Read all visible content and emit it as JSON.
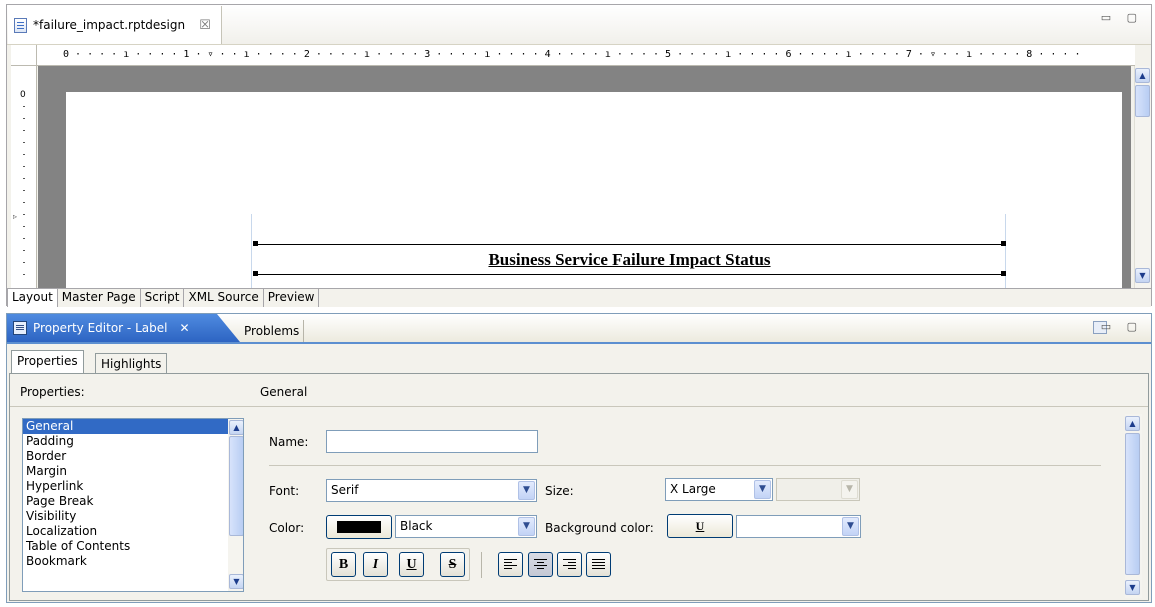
{
  "editor": {
    "tab_title": "*failure_impact.rptdesign",
    "tab_close_glyph": "☒",
    "window_controls": "▭ ▢",
    "ruler_h": "0 · · · · ı · · · · 1 · ▿ · · ı · · · · 2 · · · · ı · · · · 3 · · · · ı · · · · 4 · · · · ı · · · · 5 · · · · ı · · · · 6 · · · · ı · · · · 7 · ▿ · · ı · · · · 8 · · · ·",
    "ruler_v_zero": "0",
    "report_label": "Business Service Failure Impact Status",
    "bottom_tabs": [
      "Layout",
      "Master Page",
      "Script",
      "XML Source",
      "Preview"
    ]
  },
  "property_editor": {
    "tab_title": "Property Editor - Label",
    "tab_close_glyph": "✕",
    "second_tab": "Problems",
    "window_controls": "▭ ▢",
    "sub_tabs": [
      "Properties",
      "Highlights"
    ],
    "properties_label": "Properties:",
    "section_title": "General",
    "categories": [
      "General",
      "Padding",
      "Border",
      "Margin",
      "Hyperlink",
      "Page Break",
      "Visibility",
      "Localization",
      "Table of Contents",
      "Bookmark"
    ],
    "selected_category": "General",
    "name_label": "Name:",
    "name_value": "",
    "font_label": "Font:",
    "font_value": "Serif",
    "size_label": "Size:",
    "size_value": "X Large",
    "size_unit_value": "",
    "color_label": "Color:",
    "color_swatch": "#000000",
    "color_value": "Black",
    "bg_color_label": "Background color:",
    "bg_color_btn": "U",
    "bg_color_value": "",
    "bold_label": "B",
    "italic_label": "I",
    "underline_label": "U",
    "strike_label": "S"
  },
  "icons": {
    "file": "report-design-icon",
    "property_editor": "property-editor-icon",
    "scroll_up": "▲",
    "scroll_down": "▼",
    "dropdown": "▼"
  }
}
